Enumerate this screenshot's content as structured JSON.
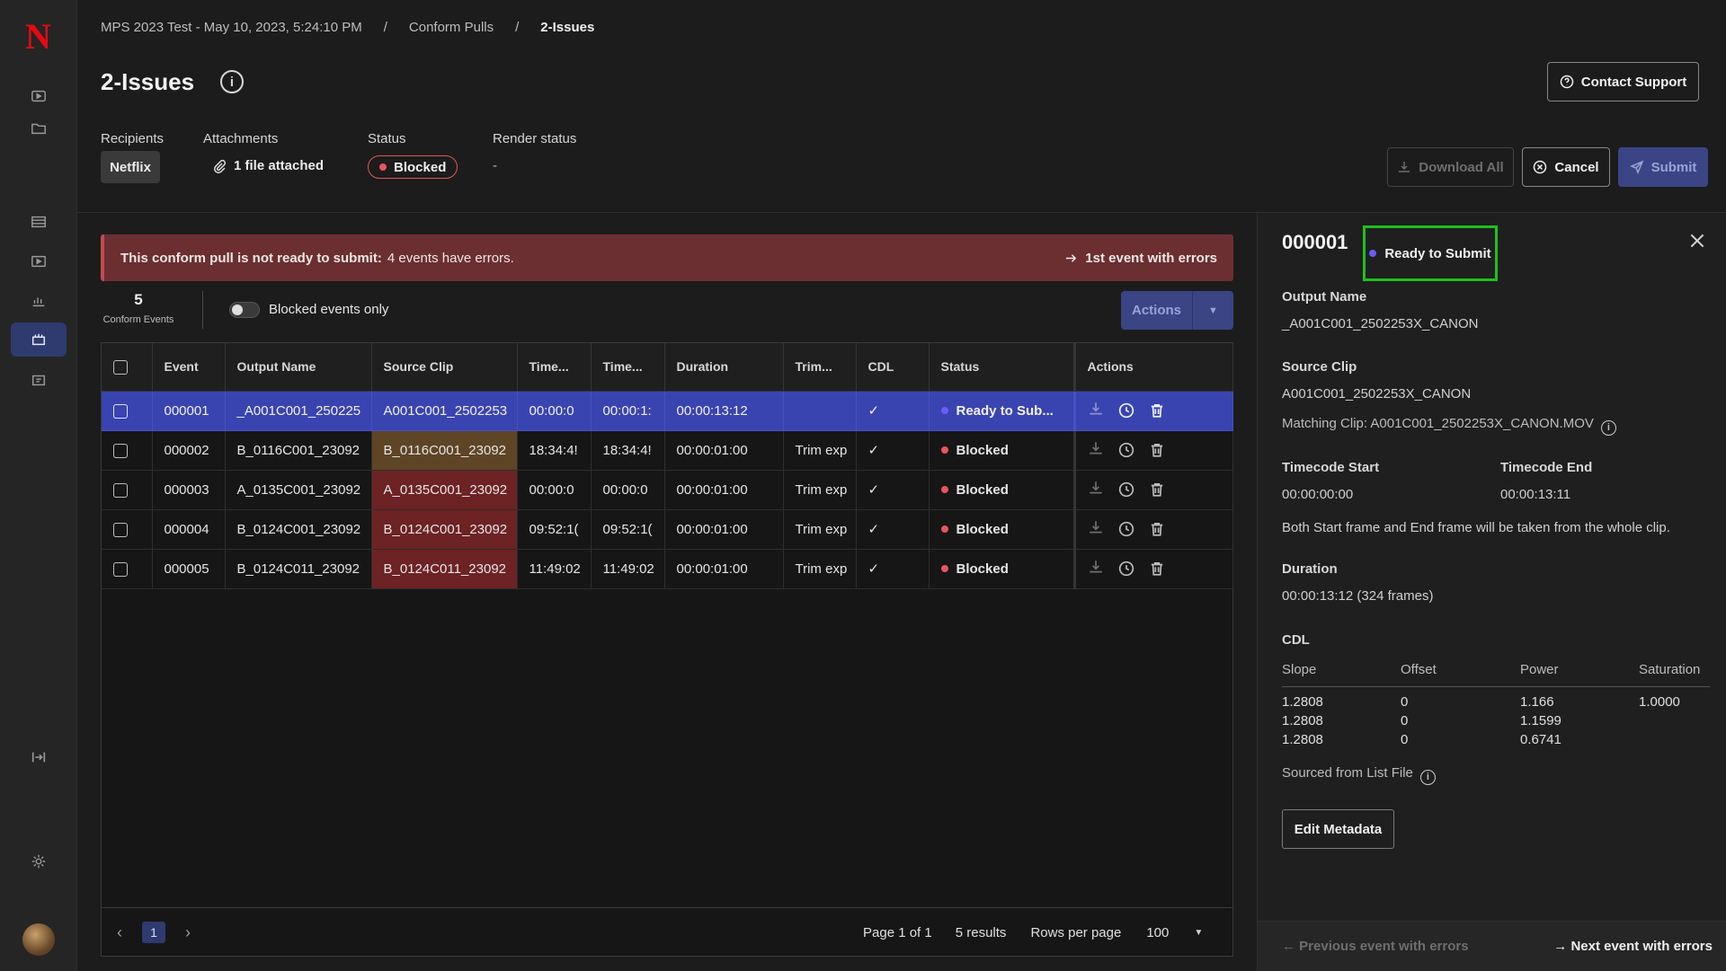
{
  "breadcrumb": {
    "items": [
      "MPS 2023 Test - May 10, 2023, 5:24:10 PM",
      "Conform Pulls",
      "2-Issues"
    ],
    "separator": "/"
  },
  "page": {
    "title": "2-Issues",
    "info_glyph": "i"
  },
  "header_buttons": {
    "contact_support": "Contact Support",
    "download_all": "Download All",
    "cancel": "Cancel",
    "submit": "Submit"
  },
  "meta": {
    "recipients_label": "Recipients",
    "recipients_value": "Netflix",
    "attachments_label": "Attachments",
    "attachments_value": "1 file attached",
    "status_label": "Status",
    "status_value": "Blocked",
    "render_status_label": "Render status",
    "render_status_value": "-"
  },
  "alert": {
    "bold": "This conform pull is not ready to submit:",
    "text": "4 events have errors.",
    "link": "1st event with errors"
  },
  "toolbar": {
    "count": "5",
    "count_label": "Conform Events",
    "toggle_label": "Blocked events only",
    "actions_label": "Actions"
  },
  "table": {
    "headers": [
      "Event",
      "Output Name",
      "Source Clip",
      "Time...",
      "Time...",
      "Duration",
      "Trim...",
      "CDL",
      "Status",
      "Actions"
    ],
    "rows": [
      {
        "event": "000001",
        "output": "_A001C001_250225",
        "source": "A001C001_2502253",
        "t1": "00:00:0",
        "t2": "00:00:1:",
        "duration": "00:00:13:12",
        "trim": "",
        "cdl": "✓",
        "status": "Ready to Sub...",
        "status_kind": "ready",
        "source_kind": "none",
        "selected": true
      },
      {
        "event": "000002",
        "output": "B_0116C001_23092",
        "source": "B_0116C001_23092",
        "t1": "18:34:4!",
        "t2": "18:34:4!",
        "duration": "00:00:01:00",
        "trim": "Trim exp",
        "cdl": "✓",
        "status": "Blocked",
        "status_kind": "blocked",
        "source_kind": "amber",
        "selected": false
      },
      {
        "event": "000003",
        "output": "A_0135C001_23092",
        "source": "A_0135C001_23092",
        "t1": "00:00:0",
        "t2": "00:00:0",
        "duration": "00:00:01:00",
        "trim": "Trim exp",
        "cdl": "✓",
        "status": "Blocked",
        "status_kind": "blocked",
        "source_kind": "red",
        "selected": false
      },
      {
        "event": "000004",
        "output": "B_0124C001_23092",
        "source": "B_0124C001_23092",
        "t1": "09:52:1(",
        "t2": "09:52:1(",
        "duration": "00:00:01:00",
        "trim": "Trim exp",
        "cdl": "✓",
        "status": "Blocked",
        "status_kind": "blocked",
        "source_kind": "red",
        "selected": false
      },
      {
        "event": "000005",
        "output": "B_0124C011_23092",
        "source": "B_0124C011_23092",
        "t1": "11:49:02",
        "t2": "11:49:02",
        "duration": "00:00:01:00",
        "trim": "Trim exp",
        "cdl": "✓",
        "status": "Blocked",
        "status_kind": "blocked",
        "source_kind": "red",
        "selected": false
      }
    ]
  },
  "pagination": {
    "current_page": "1",
    "page_of": "Page 1 of 1",
    "results": "5 results",
    "rows_per_page_label": "Rows per page",
    "rows_per_page_value": "100"
  },
  "panel": {
    "event": "000001",
    "status": "Ready to Submit",
    "output_name_label": "Output Name",
    "output_name": "_A001C001_2502253X_CANON",
    "source_clip_label": "Source Clip",
    "source_clip": "A001C001_2502253X_CANON",
    "matching_clip": "Matching Clip: A001C001_2502253X_CANON.MOV",
    "tc_start_label": "Timecode Start",
    "tc_start": "00:00:00:00",
    "tc_end_label": "Timecode End",
    "tc_end": "00:00:13:11",
    "frames_note": "Both Start frame and End frame will be taken from the whole clip.",
    "duration_label": "Duration",
    "duration": "00:00:13:12 (324 frames)",
    "cdl_label": "CDL",
    "cdl_headers": [
      "Slope",
      "Offset",
      "Power",
      "Saturation"
    ],
    "cdl_rows": [
      [
        "1.2808",
        "0",
        "1.166",
        "1.0000"
      ],
      [
        "1.2808",
        "0",
        "1.1599",
        ""
      ],
      [
        "1.2808",
        "0",
        "0.6741",
        ""
      ]
    ],
    "sourced_from": "Sourced from List File",
    "edit_button": "Edit Metadata",
    "prev_link": "Previous event with errors",
    "next_link": "Next event with errors"
  },
  "colors": {
    "accent": "#3b4485",
    "selected_row": "#3a44b0",
    "blocked": "#e8565a",
    "ready": "#6a5bff",
    "highlight_box": "#1ec01e",
    "logo": "#e50914"
  },
  "icons": [
    "netflix-logo",
    "play-icon",
    "folder-icon",
    "film-icon",
    "video-icon",
    "chart-icon",
    "conform-icon",
    "export-icon",
    "collapse-icon",
    "gear-icon",
    "avatar",
    "info-icon",
    "help-icon",
    "download-icon",
    "cancel-icon",
    "send-icon",
    "paperclip-icon",
    "arrow-right-icon",
    "chevron-down-icon",
    "check-icon",
    "clock-icon",
    "trash-icon",
    "close-icon",
    "arrow-left-icon",
    "chevron-left-icon",
    "chevron-right-icon"
  ],
  "logo_glyph": "N"
}
